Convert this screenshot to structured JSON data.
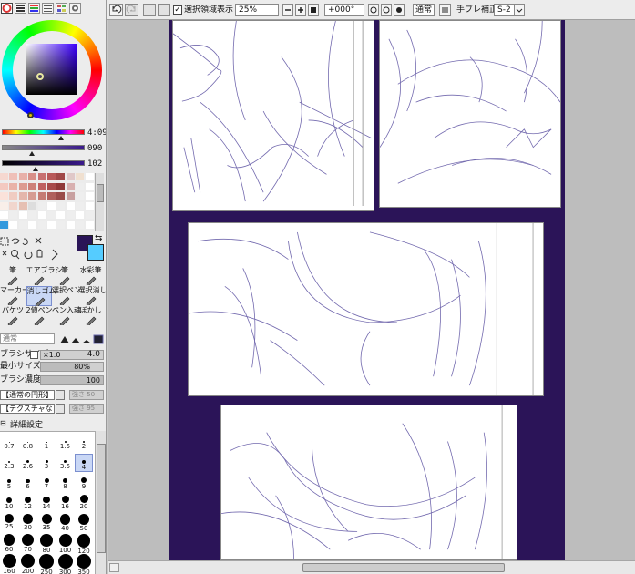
{
  "colors": {
    "page_bg": "#2b1458",
    "panel_bg": "#ffffff",
    "sketch_line": "#5a4fa0",
    "primary_color": "#2a1457",
    "secondary_color": "#55ccff",
    "selection": "#c9d7f5"
  },
  "nav": {
    "icons": [
      "color-wheel-icon",
      "rgb-sliders-icon",
      "hsv-sliders-icon",
      "intermediate-colors-icon",
      "swatches-icon",
      "scratchpad-icon",
      "user-colors-icon"
    ]
  },
  "color_panel": {
    "hue_value": "4:099",
    "saturation_value": "090",
    "value_value": "102"
  },
  "tools": {
    "row1": [
      {
        "label": "筆",
        "icon": "pen-tool-icon"
      },
      {
        "label": "エアブラシ",
        "icon": "airbrush-tool-icon"
      },
      {
        "label": "筆",
        "icon": "brush-tool-icon"
      },
      {
        "label": "水彩筆",
        "icon": "watercolor-tool-icon"
      }
    ],
    "row2": [
      {
        "label": "マーカー",
        "icon": "marker-tool-icon"
      },
      {
        "label": "消しゴム",
        "icon": "eraser-tool-icon",
        "selected": true
      },
      {
        "label": "選択ペン",
        "icon": "select-pen-tool-icon"
      },
      {
        "label": "選択消し",
        "icon": "select-eraser-tool-icon"
      }
    ],
    "row3": [
      {
        "label": "バケツ",
        "icon": "bucket-tool-icon"
      },
      {
        "label": "2値ペン",
        "icon": "binary-pen-tool-icon"
      },
      {
        "label": "ペン入魂",
        "icon": "pen-tool-icon"
      },
      {
        "label": "ぼかし",
        "icon": "blur-tool-icon"
      }
    ]
  },
  "blend_mode": "通常",
  "props": {
    "brush_size_label": "ブラシサイズ",
    "brush_size_mult": "×1.0",
    "brush_size_value": "4.0",
    "min_size_label": "最小サイズ",
    "min_size_value": "80%",
    "density_label": "ブラシ濃度",
    "density_value": "100",
    "shape_option": "【通常の円形】",
    "shape_strength": "強さ 50",
    "texture_option": "【テクスチャなし】",
    "texture_strength": "強さ 95",
    "detail_label": "詳細設定"
  },
  "brush_sizes": [
    [
      "0.7",
      "0.8",
      "1",
      "1.5",
      "2"
    ],
    [
      "2.3",
      "2.6",
      "3",
      "3.5",
      "4"
    ],
    [
      "5",
      "6",
      "7",
      "8",
      "9"
    ],
    [
      "10",
      "12",
      "14",
      "16",
      "20"
    ],
    [
      "25",
      "30",
      "35",
      "40",
      "50"
    ],
    [
      "60",
      "70",
      "80",
      "100",
      "120"
    ],
    [
      "160",
      "200",
      "250",
      "300",
      "350"
    ]
  ],
  "selected_brush_size": "4",
  "toolbar": {
    "selection_label": "選択領域表示",
    "zoom": "25%",
    "rotation": "+000°",
    "blend": "通常",
    "stabilizer_label": "手ブレ補正",
    "stabilizer_value": "S-2"
  }
}
